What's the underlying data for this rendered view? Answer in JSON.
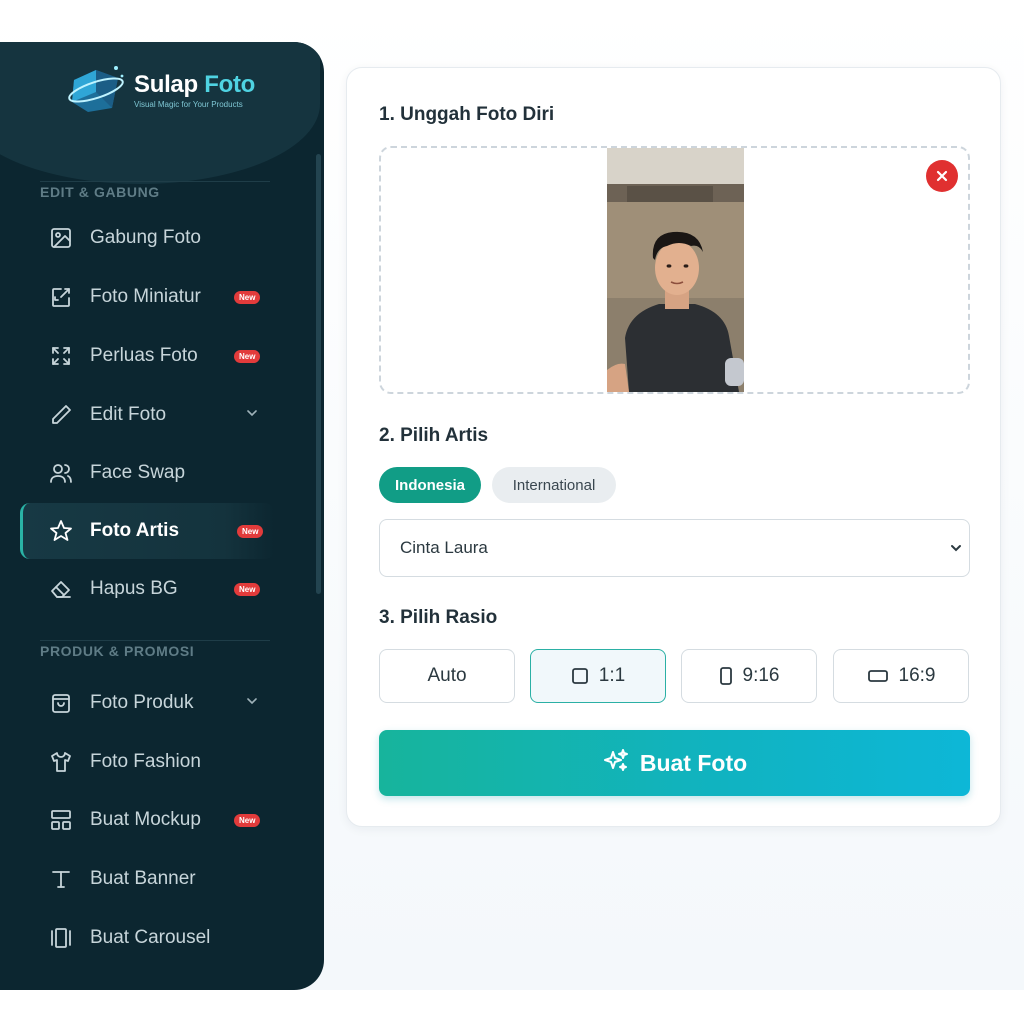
{
  "app": {
    "title_part1": "Sulap",
    "title_part2": "Foto",
    "tagline": "Visual Magic for Your Products"
  },
  "sidebar": {
    "sections": [
      {
        "label": "EDIT & GABUNG"
      },
      {
        "label": "PRODUK & PROMOSI"
      }
    ],
    "items": [
      {
        "label": "Gabung Foto",
        "icon": "image-icon"
      },
      {
        "label": "Foto Miniatur",
        "icon": "resize-icon",
        "badge": "New"
      },
      {
        "label": "Perluas Foto",
        "icon": "expand-icon",
        "badge": "New"
      },
      {
        "label": "Edit Foto",
        "icon": "pencil-icon"
      },
      {
        "label": "Face Swap",
        "icon": "users-icon"
      },
      {
        "label": "Foto Artis",
        "icon": "star-icon",
        "badge": "New",
        "active": true
      },
      {
        "label": "Hapus BG",
        "icon": "eraser-icon",
        "badge": "New"
      },
      {
        "label": "Foto Produk",
        "icon": "shopping-bag-icon"
      },
      {
        "label": "Foto Fashion",
        "icon": "shirt-icon"
      },
      {
        "label": "Buat Mockup",
        "icon": "layout-icon",
        "badge": "New"
      },
      {
        "label": "Buat Banner",
        "icon": "type-icon"
      },
      {
        "label": "Buat Carousel",
        "icon": "carousel-icon"
      }
    ]
  },
  "main": {
    "step1": {
      "title": "1. Unggah Foto Diri"
    },
    "step2": {
      "title": "2. Pilih Artis",
      "tabs": [
        {
          "label": "Indonesia",
          "active": true
        },
        {
          "label": "International",
          "active": false
        }
      ],
      "selected_artist": "Cinta Laura"
    },
    "step3": {
      "title": "3. Pilih Rasio",
      "ratios": [
        {
          "label": "Auto",
          "icon": ""
        },
        {
          "label": "1:1",
          "icon": "square-icon",
          "active": true
        },
        {
          "label": "9:16",
          "icon": "portrait-icon"
        },
        {
          "label": "16:9",
          "icon": "landscape-icon"
        }
      ]
    },
    "generate_label": "Buat Foto"
  },
  "colors": {
    "sidebar_bg": "#0c2630",
    "accent": "#119d86",
    "badge": "#e23b3b",
    "remove": "#e03030"
  }
}
